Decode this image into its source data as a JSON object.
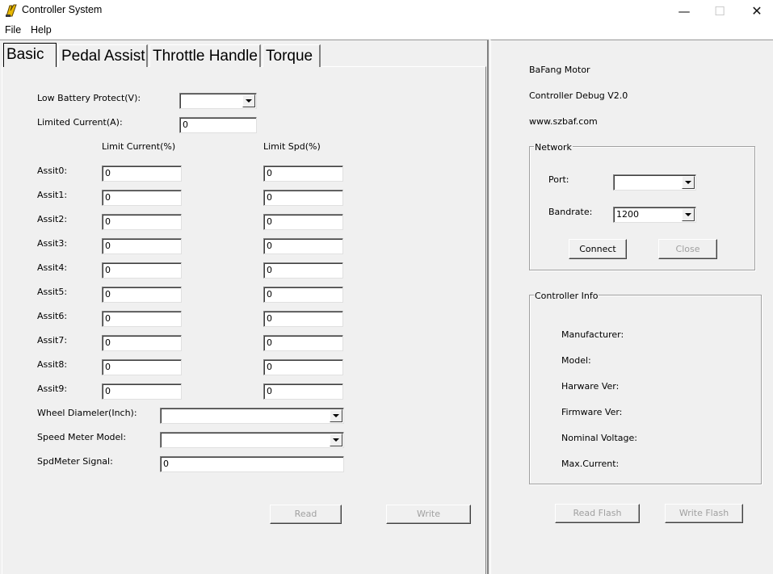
{
  "window": {
    "title": "Controller System",
    "minimize": "—",
    "maximize": "☐",
    "close": "✕"
  },
  "menu": {
    "file": "File",
    "help": "Help"
  },
  "tabs": {
    "basic": "Basic",
    "pedal_assist": "Pedal Assist",
    "throttle_handle": "Throttle Handle",
    "torque": "Torque"
  },
  "basic": {
    "low_battery_label": "Low Battery Protect(V):",
    "low_battery_value": "",
    "limited_current_label": "Limited Current(A):",
    "limited_current_value": "0",
    "col_limit_current": "Limit Current(%)",
    "col_limit_spd": "Limit Spd(%)",
    "assists": [
      {
        "label": "Assit0:",
        "current": "0",
        "spd": "0"
      },
      {
        "label": "Assit1:",
        "current": "0",
        "spd": "0"
      },
      {
        "label": "Assit2:",
        "current": "0",
        "spd": "0"
      },
      {
        "label": "Assit3:",
        "current": "0",
        "spd": "0"
      },
      {
        "label": "Assit4:",
        "current": "0",
        "spd": "0"
      },
      {
        "label": "Assit5:",
        "current": "0",
        "spd": "0"
      },
      {
        "label": "Assit6:",
        "current": "0",
        "spd": "0"
      },
      {
        "label": "Assit7:",
        "current": "0",
        "spd": "0"
      },
      {
        "label": "Assit8:",
        "current": "0",
        "spd": "0"
      },
      {
        "label": "Assit9:",
        "current": "0",
        "spd": "0"
      }
    ],
    "wheel_diameter_label": "Wheel Diameler(Inch):",
    "wheel_diameter_value": "",
    "speed_meter_model_label": "Speed Meter Model:",
    "speed_meter_model_value": "",
    "spdmeter_signal_label": "SpdMeter Signal:",
    "spdmeter_signal_value": "0",
    "read_button": "Read",
    "write_button": "Write"
  },
  "info": {
    "brand": "BaFang Motor",
    "version": "Controller Debug V2.0",
    "website": "www.szbaf.com"
  },
  "network": {
    "title": "Network",
    "port_label": "Port:",
    "port_value": "",
    "bandrate_label": "Bandrate:",
    "bandrate_value": "1200",
    "connect_button": "Connect",
    "close_button": "Close"
  },
  "controller_info": {
    "title": "Controller Info",
    "manufacturer": "Manufacturer:",
    "model": "Model:",
    "hardware_ver": "Harware Ver:",
    "firmware_ver": "Firmware Ver:",
    "nominal_voltage": "Nominal Voltage:",
    "max_current": "Max.Current:"
  },
  "flash": {
    "read_flash": "Read Flash",
    "write_flash": "Write Flash"
  }
}
